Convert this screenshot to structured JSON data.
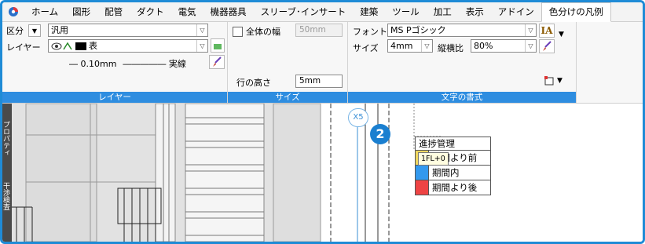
{
  "tabs": [
    {
      "label": "ホーム"
    },
    {
      "label": "図形"
    },
    {
      "label": "配管"
    },
    {
      "label": "ダクト"
    },
    {
      "label": "電気"
    },
    {
      "label": "機器器具"
    },
    {
      "label": "スリーブ･インサート"
    },
    {
      "label": "建築"
    },
    {
      "label": "ツール"
    },
    {
      "label": "加工"
    },
    {
      "label": "表示"
    },
    {
      "label": "アドイン"
    },
    {
      "label": "色分けの凡例"
    }
  ],
  "active_tab": "色分けの凡例",
  "layer_group": {
    "caption": "レイヤー",
    "kubun_label": "区分",
    "kubun_value": "汎用",
    "layer_label": "レイヤー",
    "layer_value": "表",
    "linewidth": "― 0.10mm",
    "linetype": "――――― 実線"
  },
  "size_group": {
    "caption": "サイズ",
    "full_width_label": "全体の幅",
    "full_width_value": "50mm",
    "row_height_label": "行の高さ",
    "row_height_value": "5mm"
  },
  "text_group": {
    "caption": "文字の書式",
    "font_label": "フォント",
    "font_value": "MS Pゴシック",
    "size_label": "サイズ",
    "size_value": "4mm",
    "ratio_label": "縦横比",
    "ratio_value": "80%"
  },
  "side_panel": {
    "tab1": "プロパティ",
    "tab2": "干渉検査"
  },
  "canvas": {
    "grid_bubble": "X5",
    "step_marker": "2",
    "tooltip": "1FL+0",
    "legend": {
      "title": "進捗管理",
      "rows": [
        {
          "label": "期間より前",
          "color": "#f0d860"
        },
        {
          "label": "期間内",
          "color": "#3399ee"
        },
        {
          "label": "期間より後",
          "color": "#ee4444"
        }
      ]
    }
  },
  "colors": {
    "accent": "#1f8bd6",
    "caption_bar": "#2e8de0"
  }
}
